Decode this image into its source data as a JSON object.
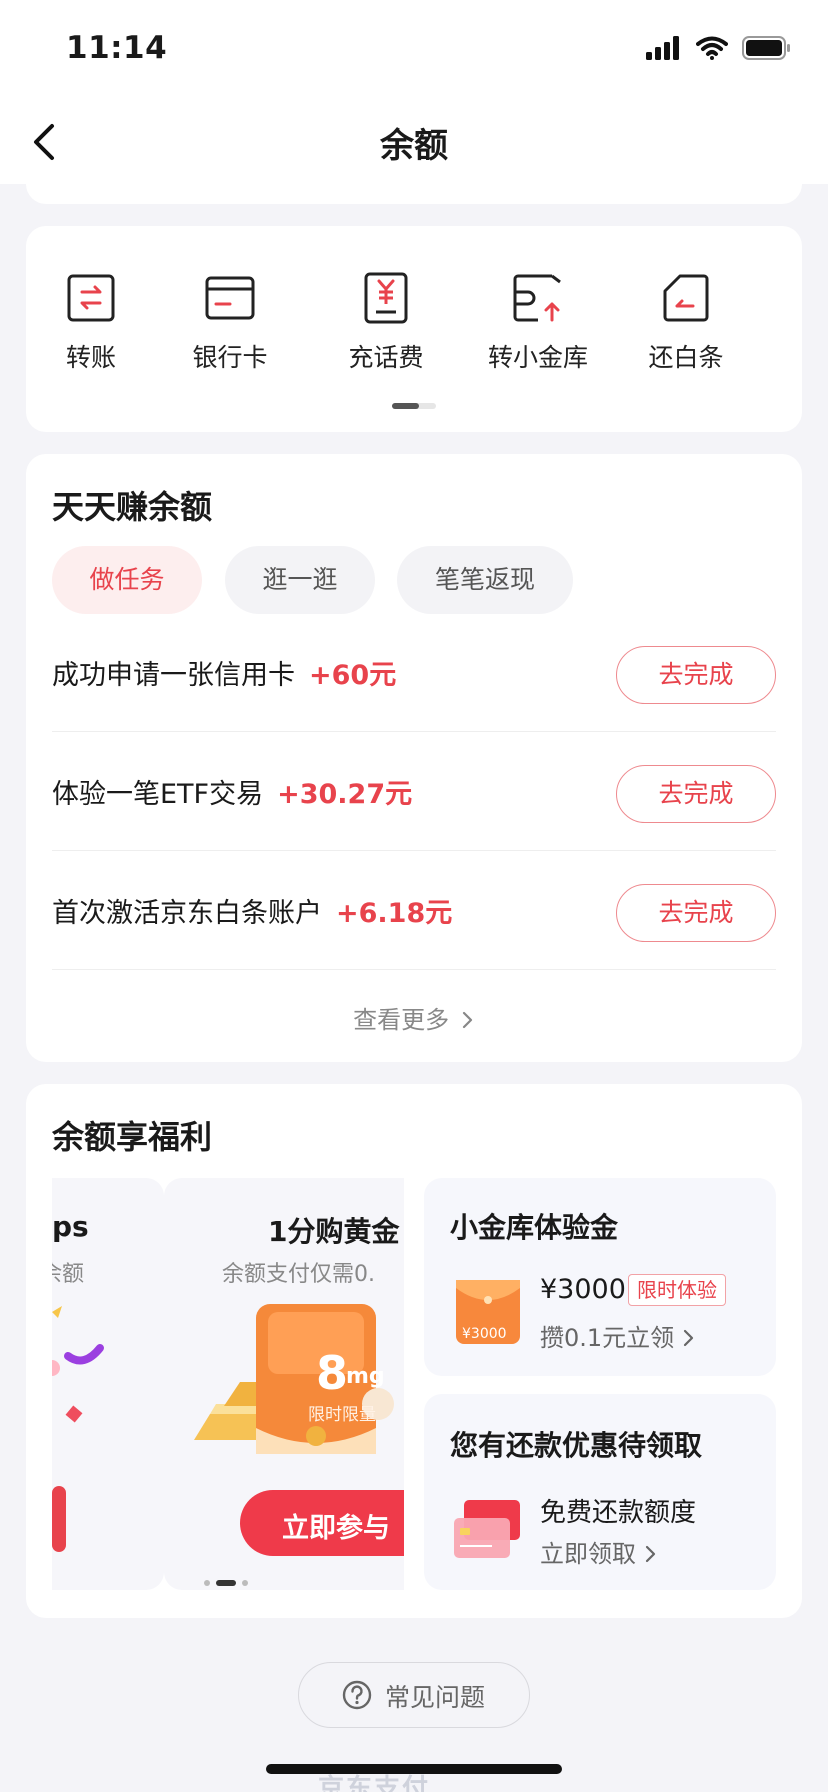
{
  "status_bar": {
    "time": "11:14"
  },
  "nav": {
    "title": "余额"
  },
  "shortcuts": [
    {
      "label": "转账",
      "icon": "transfer-icon"
    },
    {
      "label": "银行卡",
      "icon": "bank-card-icon"
    },
    {
      "label": "充话费",
      "icon": "phone-recharge-icon"
    },
    {
      "label": "转小金库",
      "icon": "vault-transfer-icon"
    },
    {
      "label": "还白条",
      "icon": "repay-icon"
    }
  ],
  "earn": {
    "title": "天天赚余额",
    "tabs": [
      {
        "label": "做任务",
        "active": true
      },
      {
        "label": "逛一逛",
        "active": false
      },
      {
        "label": "笔笔返现",
        "active": false
      }
    ],
    "tasks": [
      {
        "text": "成功申请一张信用卡",
        "reward": "+60元",
        "button": "去完成"
      },
      {
        "text": "体验一笔ETF交易",
        "reward": "+30.27元",
        "button": "去完成"
      },
      {
        "text": "首次激活京东白条账户",
        "reward": "+6.18元",
        "button": "去完成"
      }
    ],
    "more": "查看更多"
  },
  "welfare": {
    "title": "余额享福利",
    "banner_left": {
      "title_fragment": "ps",
      "subtitle_fragment": "余额"
    },
    "banner_main": {
      "title": "1分购黄金",
      "subtitle": "余额支付仅需0.",
      "product_weight": "8",
      "product_unit": "mg",
      "product_tag": "限时限量",
      "cta": "立即参与"
    },
    "vault_tile": {
      "title": "小金库体验金",
      "envelope_amount": "¥3000",
      "amount": "¥3000",
      "badge": "限时体验",
      "action": "攒0.1元立领"
    },
    "repay_tile": {
      "title": "您有还款优惠待领取",
      "line1": "免费还款额度",
      "action": "立即领取"
    }
  },
  "faq": {
    "label": "常见问题"
  },
  "footer": {
    "brand": "京东支付"
  },
  "colors": {
    "accent": "#e8434c",
    "background": "#f4f4f8",
    "card": "#ffffff"
  }
}
